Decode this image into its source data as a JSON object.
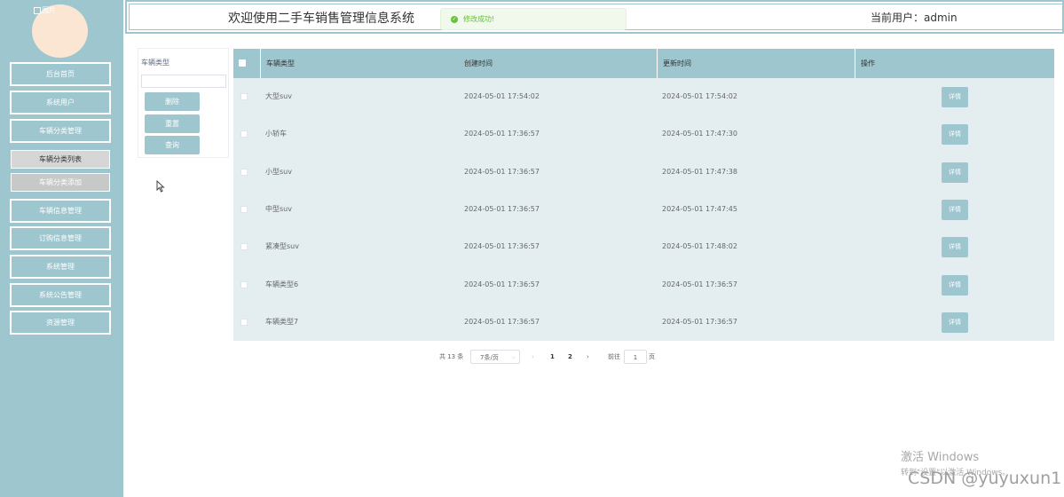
{
  "header": {
    "title": "欢迎使用二手车销售管理信息系统",
    "current_user": "当前用户：admin"
  },
  "toast": {
    "text": "修改成功!",
    "icon": "success-check-icon",
    "color": "#67c23a"
  },
  "sidebar": {
    "avatar_alt": "图片",
    "items": [
      {
        "label": "后台首页"
      },
      {
        "label": "系统用户"
      },
      {
        "label": "车辆分类管理"
      },
      {
        "label": "车辆信息管理"
      },
      {
        "label": "订购信息管理"
      },
      {
        "label": "系统管理"
      },
      {
        "label": "系统公告管理"
      },
      {
        "label": "资源管理"
      }
    ],
    "subitems": [
      {
        "label": "车辆分类列表",
        "active": true
      },
      {
        "label": "车辆分类添加",
        "active": false
      }
    ]
  },
  "search": {
    "label": "车辆类型",
    "value": "",
    "delete_label": "删除",
    "reset_label": "重置",
    "query_label": "查询"
  },
  "table": {
    "headers": [
      "车辆类型",
      "创建时间",
      "更新时间",
      "操作"
    ],
    "detail_label": "详情",
    "rows": [
      {
        "type": "大型suv",
        "created": "2024-05-01 17:54:02",
        "updated": "2024-05-01 17:54:02"
      },
      {
        "type": "小轿车",
        "created": "2024-05-01 17:36:57",
        "updated": "2024-05-01 17:47:30"
      },
      {
        "type": "小型suv",
        "created": "2024-05-01 17:36:57",
        "updated": "2024-05-01 17:47:38"
      },
      {
        "type": "中型suv",
        "created": "2024-05-01 17:36:57",
        "updated": "2024-05-01 17:47:45"
      },
      {
        "type": "紧凑型suv",
        "created": "2024-05-01 17:36:57",
        "updated": "2024-05-01 17:48:02"
      },
      {
        "type": "车辆类型6",
        "created": "2024-05-01 17:36:57",
        "updated": "2024-05-01 17:36:57"
      },
      {
        "type": "车辆类型7",
        "created": "2024-05-01 17:36:57",
        "updated": "2024-05-01 17:36:57"
      }
    ]
  },
  "pagination": {
    "total": "共 13 条",
    "page_size": "7条/页",
    "prev": "‹",
    "pages": [
      "1",
      "2"
    ],
    "current_page": "1",
    "next": "›",
    "goto_label": "前往",
    "goto_value": "1",
    "page_suffix": "页"
  },
  "watermark": {
    "windows_line1": "激活 Windows",
    "windows_line2": "转到\"设置\"以激活 Windows。",
    "csdn": "CSDN @yuyuxun1"
  },
  "colors": {
    "accent": "#9ec6cf",
    "table_bg": "#e4eef1",
    "avatar": "#fbe6d4"
  }
}
